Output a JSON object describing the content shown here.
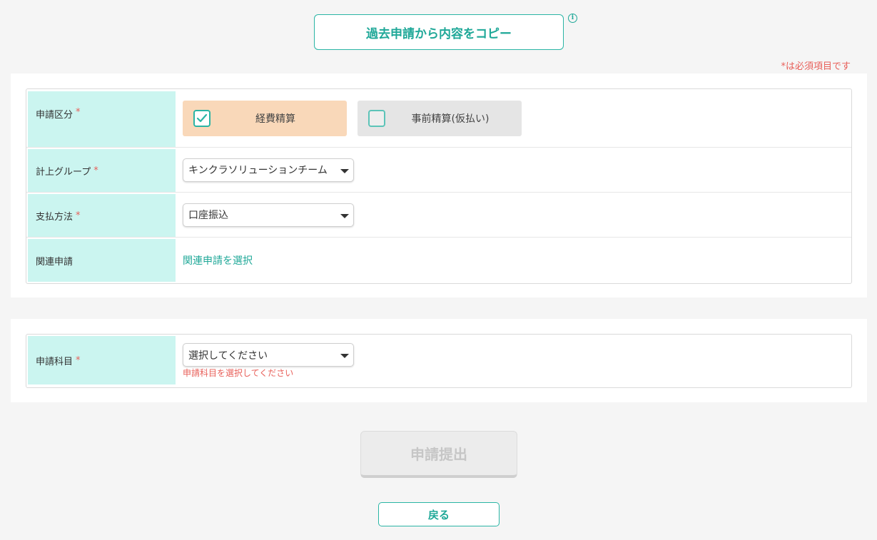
{
  "header": {
    "copy_button_label": "過去申請から内容をコピー",
    "info_icon": "info-circle-icon",
    "required_note": "*は必須項目です"
  },
  "form": {
    "category": {
      "label": "申請区分",
      "required_mark": "*",
      "options": [
        {
          "label": "経費精算",
          "checked": true
        },
        {
          "label": "事前精算(仮払い)",
          "checked": false
        }
      ]
    },
    "group": {
      "label": "計上グループ",
      "required_mark": "*",
      "selected": "キンクラソリューションチーム"
    },
    "payment": {
      "label": "支払方法",
      "required_mark": "*",
      "selected": "口座振込"
    },
    "related": {
      "label": "関連申請",
      "link": "関連申請を選択"
    },
    "subject": {
      "label": "申請科目",
      "required_mark": "*",
      "selected": "選択してください",
      "error": "申請科目を選択してください"
    }
  },
  "actions": {
    "submit_label": "申請提出",
    "back_label": "戻る"
  },
  "colors": {
    "accent": "#1fa898",
    "label_bg": "#cbf5f0",
    "selected_option_bg": "#f9d8b9",
    "error": "#e8605a"
  }
}
